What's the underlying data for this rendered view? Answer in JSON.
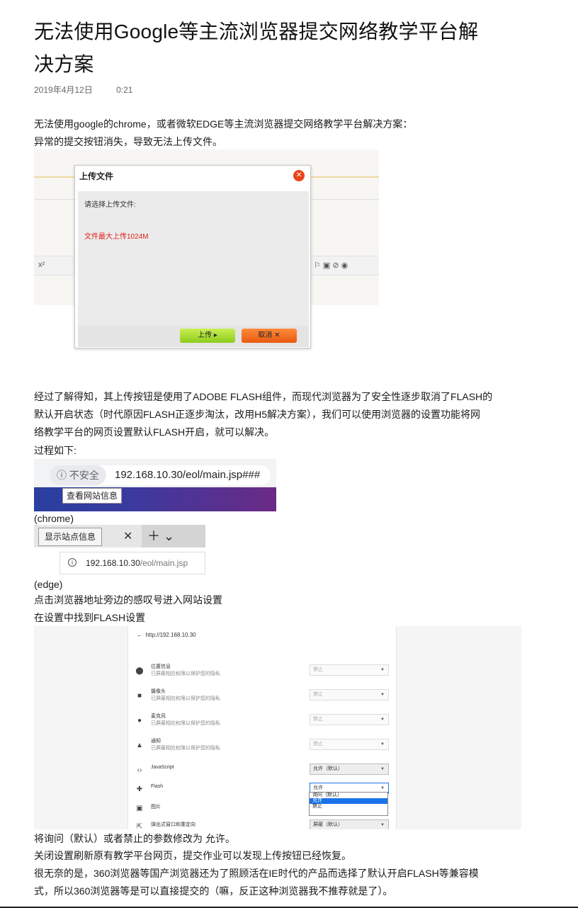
{
  "article": {
    "title": "无法使用Google等主流浏览器提交网络教学平台解决方案",
    "date": "2019年4月12日",
    "time": "0:21",
    "intro1": "无法使用google的chrome，或者微软EDGE等主流浏览器提交网络教学平台解决方案：",
    "intro2": "异常的提交按钮消失，导致无法上传文件。",
    "para1_l1": "经过了解得知，其上传按钮是使用了ADOBE FLASH组件，而现代浏览器为了安全性逐步取消了FLASH的",
    "para1_l2": "默认开启状态（时代原因FLASH正逐步淘汰，改用H5解决方案），我们可以使用浏览器的设置功能将网",
    "para1_l3": "络教学平台的网页设置默认FLASH开启，就可以解决。",
    "process": "过程如下:",
    "chrome_caption": "(chrome)",
    "edge_caption": "(edge)",
    "step1": "点击浏览器地址旁边的感叹号进入网站设置",
    "step2": "在设置中找到FLASH设置",
    "step3": "将询问（默认）或者禁止的参数修改为 允许。",
    "step4": "关闭设置刷新原有教学平台网页，提交作业可以发现上传按钮已经恢复。",
    "end_l1": "很无奈的是，360浏览器等国产浏览器还为了照顾活在IE时代的产品而选择了默认开启FLASH等兼容模",
    "end_l2": "式，所以360浏览器等是可以直接提交的（嘛，反正这种浏览器我不推荐就是了）。"
  },
  "upload_dialog": {
    "title": "上传文件",
    "prompt": "请选择上传文件:",
    "limit": "文件最大上传1024M",
    "upload_btn": "上传",
    "cancel_btn": "取消"
  },
  "chrome_shot": {
    "insecure": "不安全",
    "url": "192.168.10.30/eol/main.jsp###",
    "tooltip": "查看网站信息"
  },
  "edge_shot": {
    "tooltip": "显示站点信息",
    "url_host": "192.168.10.30",
    "url_path": "/eol/main.jsp"
  },
  "settings_shot": {
    "site": "http://192.168.10.30",
    "rows": [
      {
        "name": "位置信息",
        "desc": "已屏蔽相应权限以保护您的隐私",
        "value": "禁止"
      },
      {
        "name": "摄像头",
        "desc": "已屏蔽相应权限以保护您的隐私",
        "value": "禁止"
      },
      {
        "name": "麦克风",
        "desc": "已屏蔽相应权限以保护您的隐私",
        "value": "禁止"
      },
      {
        "name": "通知",
        "desc": "已屏蔽相应权限以保护您的隐私",
        "value": "禁止"
      },
      {
        "name": "JavaScript",
        "desc": "",
        "value": "允许（默认）"
      },
      {
        "name": "Flash",
        "desc": "",
        "value": "允许"
      },
      {
        "name": "图片",
        "desc": "",
        "value": ""
      },
      {
        "name": "弹出式窗口和重定向",
        "desc": "",
        "value": "屏蔽（默认）"
      }
    ],
    "dropdown": [
      "询问（默认）",
      "允许",
      "禁止"
    ]
  }
}
